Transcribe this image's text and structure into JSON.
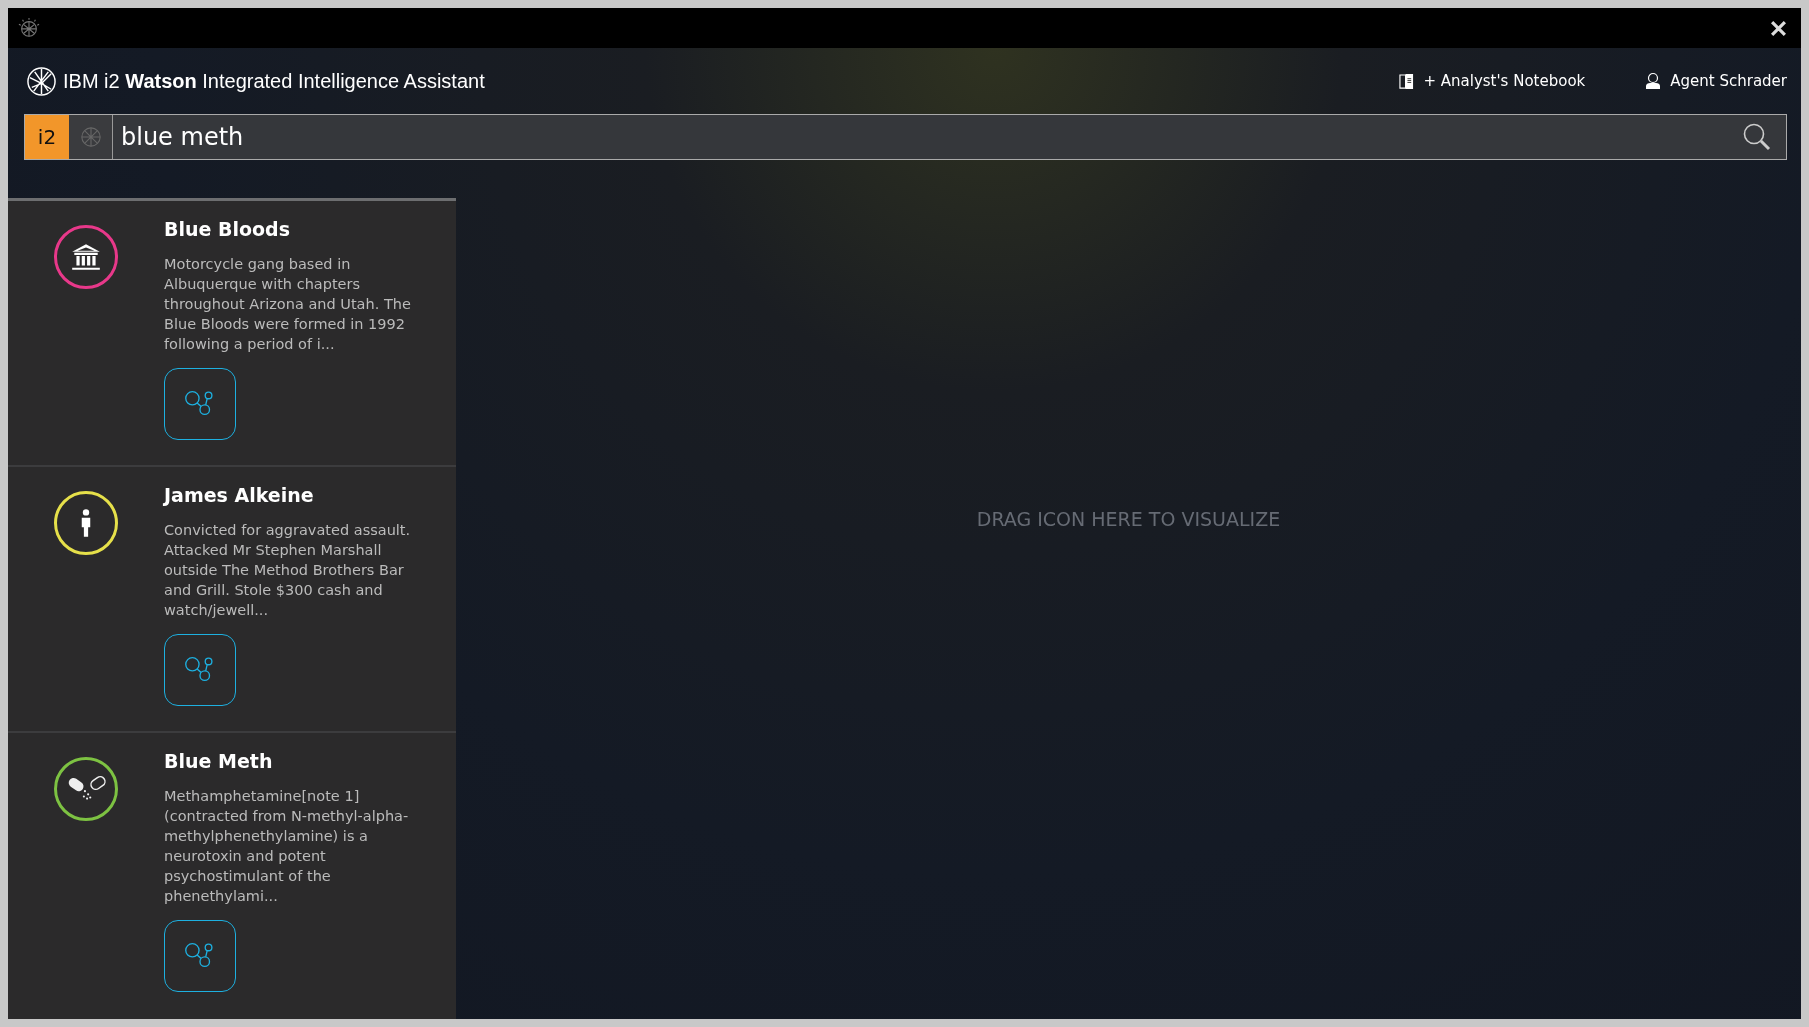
{
  "app": {
    "title_prefix": "IBM i2 ",
    "title_bold": "Watson",
    "title_suffix": " Integrated Intelligence Assistant"
  },
  "header_links": [
    {
      "kind": "notebook",
      "label": "+ Analyst's Notebook"
    },
    {
      "kind": "user",
      "label": "Agent Schrader"
    }
  ],
  "search": {
    "source_label": "i2",
    "value": "blue meth"
  },
  "results": [
    {
      "kind": "organization",
      "color": "#e8388a",
      "title": "Blue Bloods",
      "description": "Motorcycle gang based in Albuquerque with chapters throughout Arizona and Utah. The Blue Bloods were formed in 1992 following a period of i..."
    },
    {
      "kind": "person",
      "color": "#e6e04a",
      "title": "James Alkeine",
      "description": "Convicted for aggravated assault. Attacked Mr Stephen Marshall outside The Method Brothers Bar and Grill. Stole $300 cash and watch/jewell..."
    },
    {
      "kind": "drug",
      "color": "#7dc242",
      "title": "Blue Meth",
      "description": "Methamphetamine[note 1] (contracted from N-methyl-alpha-methylphenethylamine) is a neurotoxin and potent psychostimulant of the phenethylami..."
    }
  ],
  "drop_zone": {
    "hint": "DRAG ICON HERE TO VISUALIZE"
  }
}
